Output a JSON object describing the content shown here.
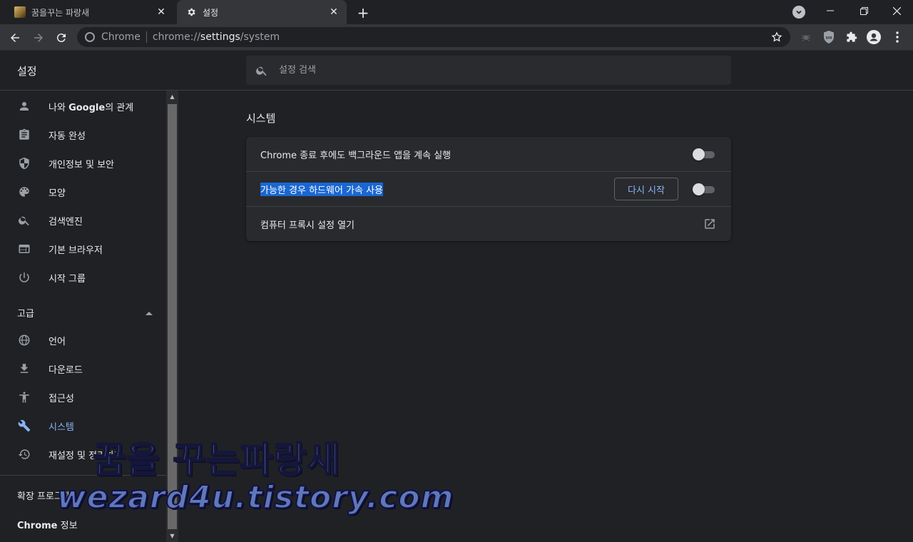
{
  "browser": {
    "tabs": [
      {
        "title": "꿈을꾸는 파랑새",
        "active": false
      },
      {
        "title": "설정",
        "active": true
      }
    ],
    "omnibox": {
      "site_chip": "Chrome",
      "url_scheme": "chrome://",
      "url_host": "settings",
      "url_path": "/system"
    }
  },
  "settings": {
    "title": "설정",
    "search_placeholder": "설정 검색",
    "sidebar": {
      "items": [
        {
          "label_prefix": "나와 ",
          "label_bold": "Google",
          "label_suffix": "의 관계",
          "icon": "person-icon"
        },
        {
          "label": "자동 완성",
          "icon": "clipboard-icon"
        },
        {
          "label": "개인정보 및 보안",
          "icon": "shield-icon"
        },
        {
          "label": "모양",
          "icon": "palette-icon"
        },
        {
          "label": "검색엔진",
          "icon": "search-icon"
        },
        {
          "label": "기본 브라우저",
          "icon": "browser-icon"
        },
        {
          "label": "시작 그룹",
          "icon": "power-icon"
        }
      ],
      "advanced_label": "고급",
      "advanced_items": [
        {
          "label": "언어",
          "icon": "globe-icon"
        },
        {
          "label": "다운로드",
          "icon": "download-icon"
        },
        {
          "label": "접근성",
          "icon": "accessibility-icon"
        },
        {
          "label": "시스템",
          "icon": "wrench-icon",
          "active": true
        },
        {
          "label": "재설정 및 정리하기",
          "icon": "restore-icon"
        }
      ],
      "extensions_label": "확장 프로그램",
      "about_bold": "Chrome",
      "about_suffix": " 정보"
    },
    "main": {
      "section_title": "시스템",
      "rows": [
        {
          "label": "Chrome 종료 후에도 백그라운드 앱을 계속 실행",
          "toggle": false
        },
        {
          "label": "가능한 경우 하드웨어 가속 사용",
          "toggle": false,
          "button": "다시 시작",
          "selected": true
        },
        {
          "label": "컴퓨터 프록시 설정 열기",
          "external": true
        }
      ]
    }
  },
  "watermark": {
    "line1": "꿈을 꾸는파랑새",
    "line2": "wezard4u.tistory.com"
  },
  "colors": {
    "background": "#202124",
    "card": "#292a2d",
    "accent": "#8ab4f8",
    "selection": "#1967d2"
  }
}
